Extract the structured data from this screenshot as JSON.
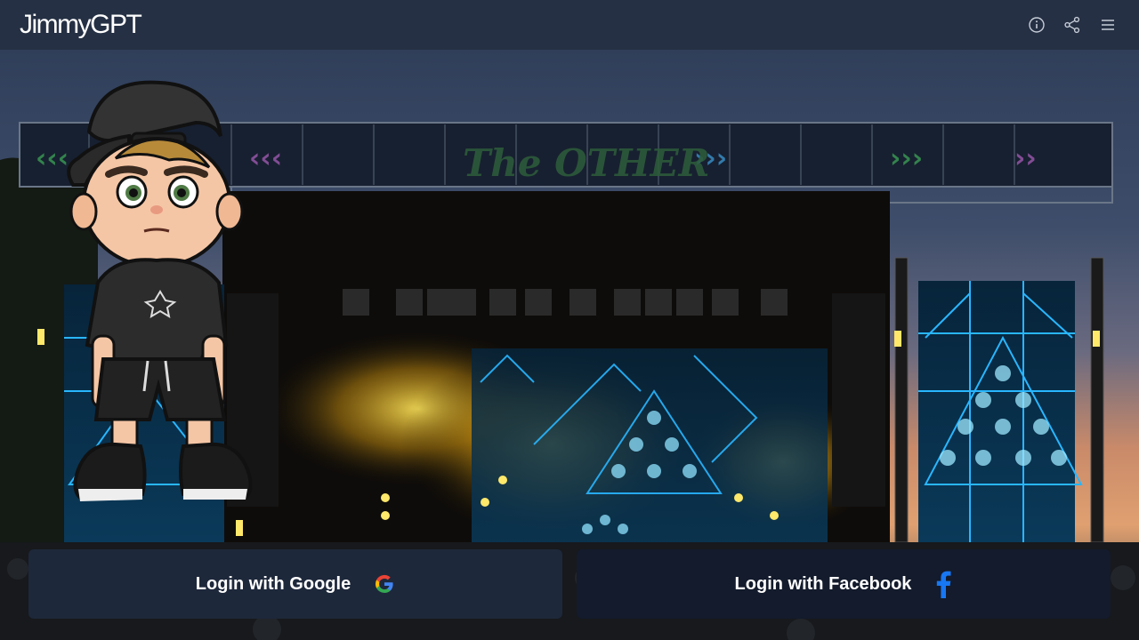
{
  "app": {
    "title": "JimmyGPT"
  },
  "header": {
    "actions": [
      {
        "icon": "info-icon",
        "label": "Info"
      },
      {
        "icon": "share-icon",
        "label": "Share"
      },
      {
        "icon": "menu-icon",
        "label": "Menu"
      }
    ]
  },
  "hero": {
    "background": "concert-stage-image",
    "stage_banner_text": "The OTHER",
    "mascot": "cartoon-boy-backwards-cap-mascot"
  },
  "login": {
    "google_label": "Login with Google",
    "google_icon": "google-logo-icon",
    "facebook_label": "Login with Facebook",
    "facebook_icon": "facebook-logo-icon"
  },
  "colors": {
    "header_bg": "#253044",
    "google_button_bg": "#1e283b",
    "facebook_button_bg": "#131b2c",
    "facebook_blue": "#1877f2",
    "stage_cyan": "#27b4ff",
    "stage_yellow": "#ffd21a"
  }
}
